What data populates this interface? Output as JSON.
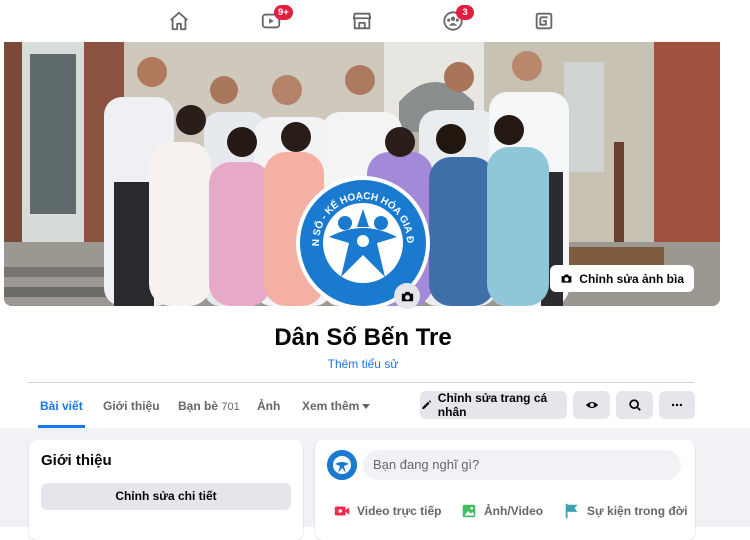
{
  "topnav": {
    "items": [
      {
        "name": "home",
        "icon": "home-icon",
        "badge": ""
      },
      {
        "name": "watch",
        "icon": "video-icon",
        "badge": "9+"
      },
      {
        "name": "marketplace",
        "icon": "store-icon",
        "badge": ""
      },
      {
        "name": "groups",
        "icon": "groups-icon",
        "badge": "3"
      },
      {
        "name": "gaming",
        "icon": "gaming-icon",
        "badge": ""
      }
    ]
  },
  "cover": {
    "edit_label": "Chỉnh sửa ảnh bìa",
    "logo_text": "DÂN SỐ - KẾ HOẠCH HÓA GIA ĐÌNH"
  },
  "profile": {
    "name": "Dân Số Bến Tre",
    "bio_link": "Thêm tiểu sử"
  },
  "tabs": [
    {
      "label": "Bài viết",
      "active": true
    },
    {
      "label": "Giới thiệu"
    },
    {
      "label": "Bạn bè",
      "count": "701"
    },
    {
      "label": "Ảnh"
    },
    {
      "label": "Xem thêm"
    }
  ],
  "actions": {
    "edit_profile": "Chỉnh sửa trang cá nhân"
  },
  "intro": {
    "title": "Giới thiệu",
    "edit_details": "Chỉnh sửa chi tiết"
  },
  "composer": {
    "placeholder": "Bạn đang nghĩ gì?",
    "live": "Video trực tiếp",
    "photo": "Ảnh/Video",
    "event": "Sự kiện trong đời"
  },
  "colors": {
    "accent": "#1877f2",
    "badge": "#e41e3f",
    "live": "#f02849",
    "photo": "#45bd62",
    "event": "#3ea2b5"
  }
}
